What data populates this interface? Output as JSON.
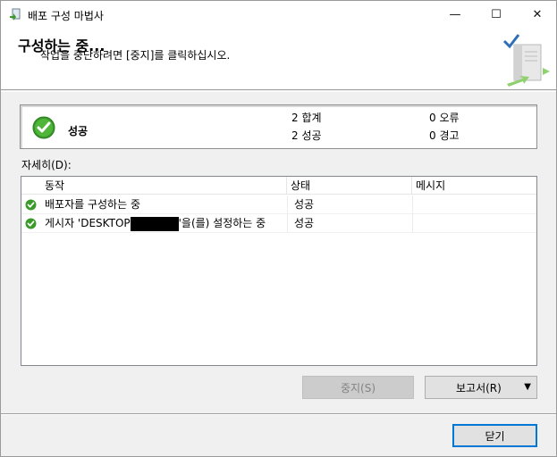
{
  "window": {
    "title": "배포 구성 마법사",
    "minimize_glyph": "—",
    "maximize_glyph": "☐",
    "close_glyph": "✕"
  },
  "header": {
    "title": "구성하는 중...",
    "subtitle": "작업을 중단하려면 [중지]를 클릭하십시오."
  },
  "summary": {
    "status": "성공",
    "total": "2 합계",
    "success": "2 성공",
    "errors": "0 오류",
    "warnings": "0 경고"
  },
  "details": {
    "label": "자세히(D):",
    "columns": [
      "동작",
      "상태",
      "메시지"
    ],
    "rows": [
      {
        "action": "배포자를 구성하는 중",
        "status": "성공",
        "message": ""
      },
      {
        "action_prefix": "게시자 'DESKTOP",
        "action_suffix": "'을(를) 설정하는 중",
        "status": "성공",
        "message": ""
      }
    ]
  },
  "buttons": {
    "stop": "중지(S)",
    "report": "보고서(R)",
    "report_arrow": "▼",
    "close": "닫기"
  },
  "colors": {
    "success_green": "#3a9a2a",
    "accent_blue": "#0078d7"
  }
}
